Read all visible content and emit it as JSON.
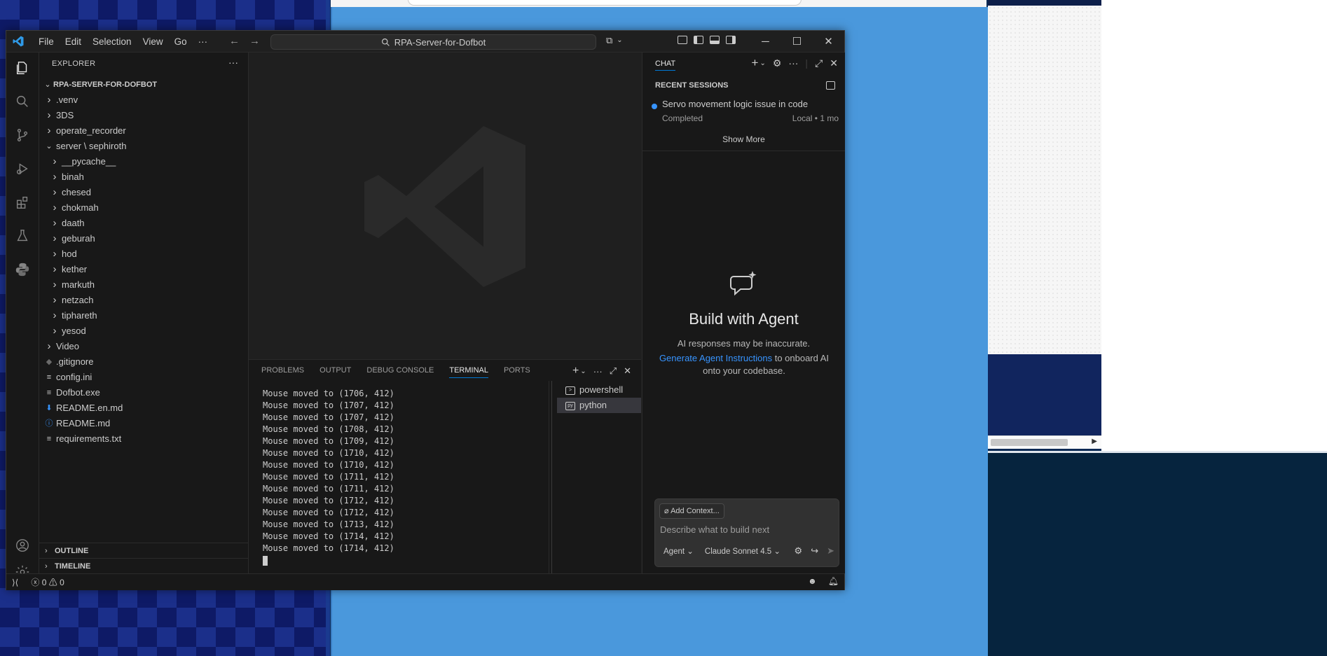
{
  "window": {
    "menu": [
      "File",
      "Edit",
      "Selection",
      "View",
      "Go",
      "···"
    ],
    "search_label": "RPA-Server-for-Dofbot",
    "controls": {
      "minimize": "─",
      "maximize": "☐",
      "close": "✕"
    }
  },
  "explorer": {
    "header": "EXPLORER",
    "more": "···",
    "root": "RPA-SERVER-FOR-DOFBOT",
    "items": [
      {
        "label": ".venv",
        "depth": 1,
        "kind": "folder",
        "open": false
      },
      {
        "label": "3DS",
        "depth": 1,
        "kind": "folder",
        "open": false
      },
      {
        "label": "operate_recorder",
        "depth": 1,
        "kind": "folder",
        "open": false
      },
      {
        "label": "server \\ sephiroth",
        "depth": 1,
        "kind": "folder",
        "open": true
      },
      {
        "label": "__pycache__",
        "depth": 2,
        "kind": "folder",
        "open": false
      },
      {
        "label": "binah",
        "depth": 2,
        "kind": "folder",
        "open": false
      },
      {
        "label": "chesed",
        "depth": 2,
        "kind": "folder",
        "open": false
      },
      {
        "label": "chokmah",
        "depth": 2,
        "kind": "folder",
        "open": false
      },
      {
        "label": "daath",
        "depth": 2,
        "kind": "folder",
        "open": false
      },
      {
        "label": "geburah",
        "depth": 2,
        "kind": "folder",
        "open": false
      },
      {
        "label": "hod",
        "depth": 2,
        "kind": "folder",
        "open": false
      },
      {
        "label": "kether",
        "depth": 2,
        "kind": "folder",
        "open": false
      },
      {
        "label": "markuth",
        "depth": 2,
        "kind": "folder",
        "open": false
      },
      {
        "label": "netzach",
        "depth": 2,
        "kind": "folder",
        "open": false
      },
      {
        "label": "tiphareth",
        "depth": 2,
        "kind": "folder",
        "open": false
      },
      {
        "label": "yesod",
        "depth": 2,
        "kind": "folder",
        "open": false
      },
      {
        "label": "Video",
        "depth": 1,
        "kind": "folder",
        "open": false
      },
      {
        "label": ".gitignore",
        "depth": 1,
        "kind": "file",
        "icon": "◆",
        "icon_color": "#6b6b6b"
      },
      {
        "label": "config.ini",
        "depth": 1,
        "kind": "file",
        "icon": "≡",
        "icon_color": "#cccccc"
      },
      {
        "label": "Dofbot.exe",
        "depth": 1,
        "kind": "file",
        "icon": "≡",
        "icon_color": "#cccccc"
      },
      {
        "label": "README.en.md",
        "depth": 1,
        "kind": "file",
        "icon": "⬇",
        "icon_color": "#3794ff"
      },
      {
        "label": "README.md",
        "depth": 1,
        "kind": "file",
        "icon": "ⓘ",
        "icon_color": "#3794ff"
      },
      {
        "label": "requirements.txt",
        "depth": 1,
        "kind": "file",
        "icon": "≡",
        "icon_color": "#cccccc"
      }
    ],
    "outline": "OUTLINE",
    "timeline": "TIMELINE"
  },
  "panel": {
    "tabs": [
      "PROBLEMS",
      "OUTPUT",
      "DEBUG CONSOLE",
      "TERMINAL",
      "PORTS"
    ],
    "active_tab": "TERMINAL",
    "terminal_lines": [
      "Mouse moved to (1706, 412)",
      "Mouse moved to (1707, 412)",
      "Mouse moved to (1707, 412)",
      "Mouse moved to (1708, 412)",
      "Mouse moved to (1709, 412)",
      "Mouse moved to (1710, 412)",
      "Mouse moved to (1710, 412)",
      "Mouse moved to (1711, 412)",
      "Mouse moved to (1711, 412)",
      "Mouse moved to (1712, 412)",
      "Mouse moved to (1712, 412)",
      "Mouse moved to (1713, 412)",
      "Mouse moved to (1714, 412)",
      "Mouse moved to (1714, 412)"
    ],
    "terminals": [
      "powershell",
      "python"
    ],
    "selected_terminal": "python"
  },
  "chat": {
    "tab": "CHAT",
    "recent_header": "RECENT SESSIONS",
    "session": {
      "title": "Servo movement logic issue in code",
      "status": "Completed",
      "meta": "Local • 1 mo"
    },
    "show_more": "Show More",
    "hero_title": "Build with Agent",
    "hero_sub": "AI responses may be inaccurate.",
    "link_text": "Generate Agent Instructions",
    "link_rest": " to onboard AI onto your codebase.",
    "add_context": "Add Context...",
    "placeholder": "Describe what to build next",
    "mode": "Agent",
    "model": "Claude Sonnet 4.5"
  },
  "status": {
    "errors": "0",
    "warnings": "0"
  },
  "colors": {
    "accent": "#0078d4",
    "link": "#3794ff",
    "bg": "#1f1f1f",
    "sidebar": "#181818"
  }
}
